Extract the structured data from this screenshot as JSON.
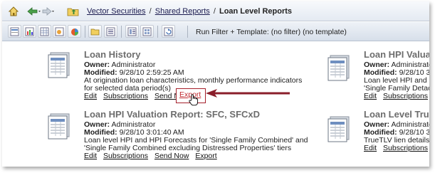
{
  "breadcrumb": {
    "items": [
      "Vector Securities",
      "Shared Reports"
    ],
    "separator": "/",
    "current": "Loan Level Reports"
  },
  "toolbar": {
    "filter_text": "Run Filter + Template:   (no filter)   (no template)"
  },
  "reports": [
    {
      "title": "Loan History",
      "owner_label": "Owner:",
      "owner": "Administrator",
      "modified_label": "Modified:",
      "modified": "9/28/10 2:59:25 AM",
      "desc1": "At origination loan characteristics, monthly performance indicators",
      "desc2": "for selected data period(s)",
      "links": [
        "Edit",
        "Subscriptions",
        "Send Now",
        "Export"
      ]
    },
    {
      "title": "Loan HPI Valuation Report: SFC, SFCxD",
      "owner_label": "Owner:",
      "owner": "Administrator",
      "modified_label": "Modified:",
      "modified": "9/28/10 3:01:40 AM",
      "desc1": "Loan level HPI and HPI Forecasts for 'Single Family Combined' and",
      "desc2": "'Single Family Combined excluding Distressed Properties' tiers",
      "links": [
        "Edit",
        "Subscriptions",
        "Send Now",
        "Export"
      ]
    },
    {
      "title": "Loan HPI Valua",
      "owner_label": "Owner:",
      "owner": "Administrator",
      "modified_label": "Modified:",
      "modified": "9/28/10 3",
      "desc1": "Loan level HPI and HPI",
      "desc2": "'Single Family Detached",
      "links": [
        "Edit",
        "Subscriptions",
        "Se"
      ]
    },
    {
      "title": "Loan Level Tru",
      "owner_label": "Owner:",
      "owner": "Administrator",
      "modified_label": "Modified:",
      "modified": "9/28/10 3",
      "desc1": "TrueTLV lien details (up",
      "links": [
        "Edit",
        "Subscriptions",
        "Se"
      ]
    }
  ],
  "colors": {
    "highlight": "#a5202b",
    "arrow": "#8a1e2a",
    "title_gray": "#6d6d6d"
  }
}
